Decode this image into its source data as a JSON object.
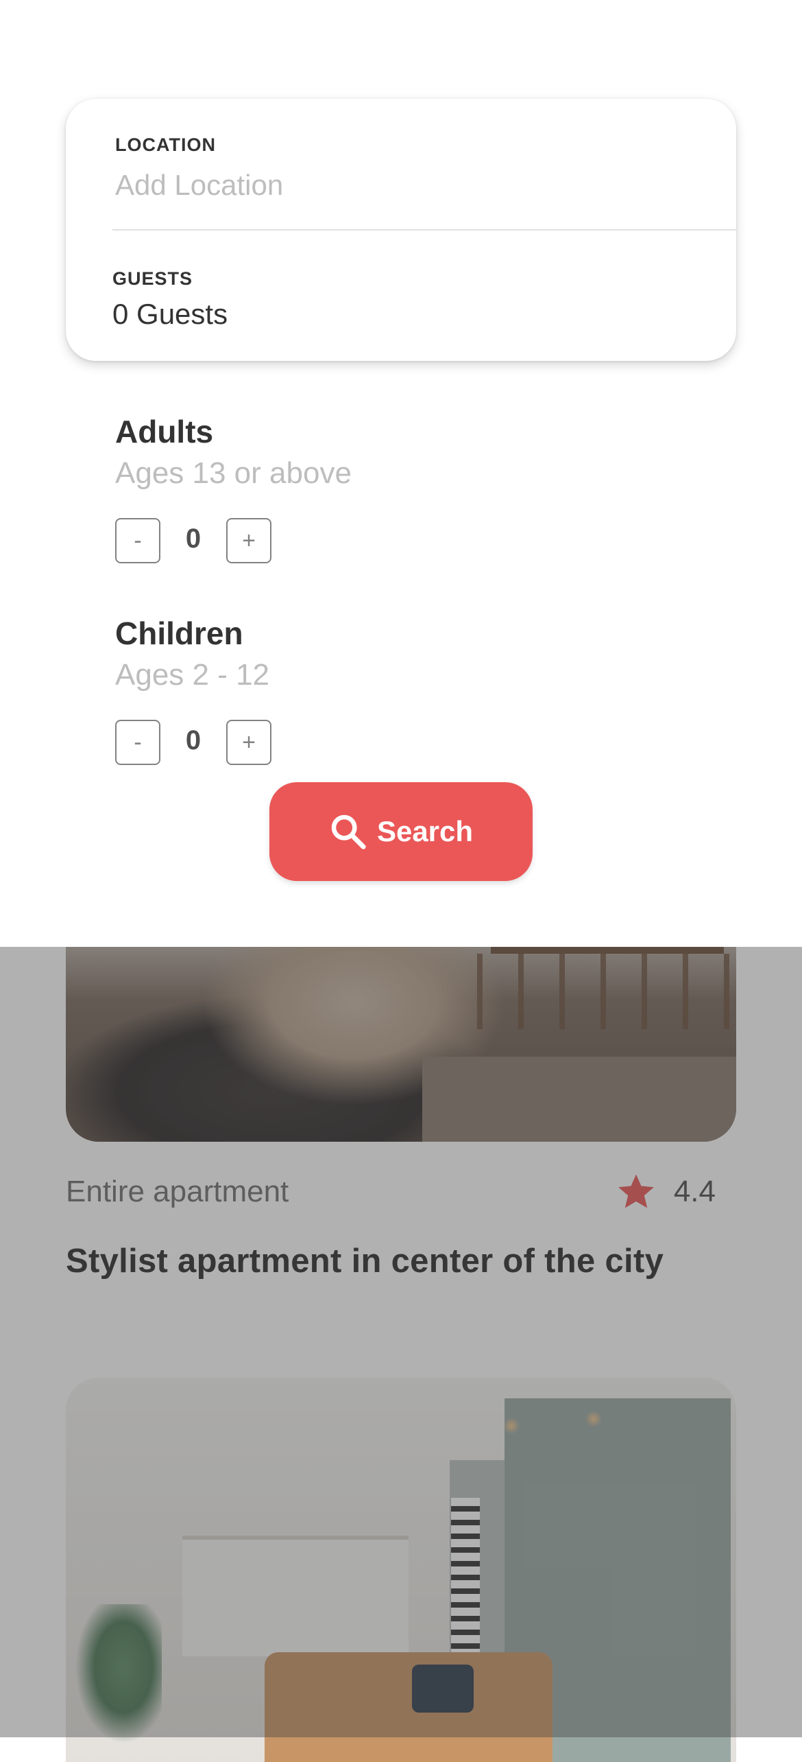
{
  "search": {
    "location_label": "LOCATION",
    "location_placeholder": "Add Location",
    "location_value": "",
    "guests_label": "GUESTS",
    "guests_value": "0 Guests"
  },
  "guests": {
    "adults": {
      "title": "Adults",
      "subtitle": "Ages 13 or above",
      "count": "0",
      "decrement": "-",
      "increment": "+"
    },
    "children": {
      "title": "Children",
      "subtitle": "Ages 2 - 12",
      "count": "0",
      "decrement": "-",
      "increment": "+"
    }
  },
  "search_button": {
    "label": "Search",
    "icon": "search-icon"
  },
  "listing": {
    "room_type": "Entire apartment",
    "rating": "4.4",
    "rating_icon": "star-icon",
    "title": "Stylist apartment in center of the city"
  },
  "colors": {
    "accent": "#eb5757",
    "text": "#333333",
    "placeholder": "#bdbdbd",
    "overlay": "rgba(70,70,70,0.42)"
  }
}
